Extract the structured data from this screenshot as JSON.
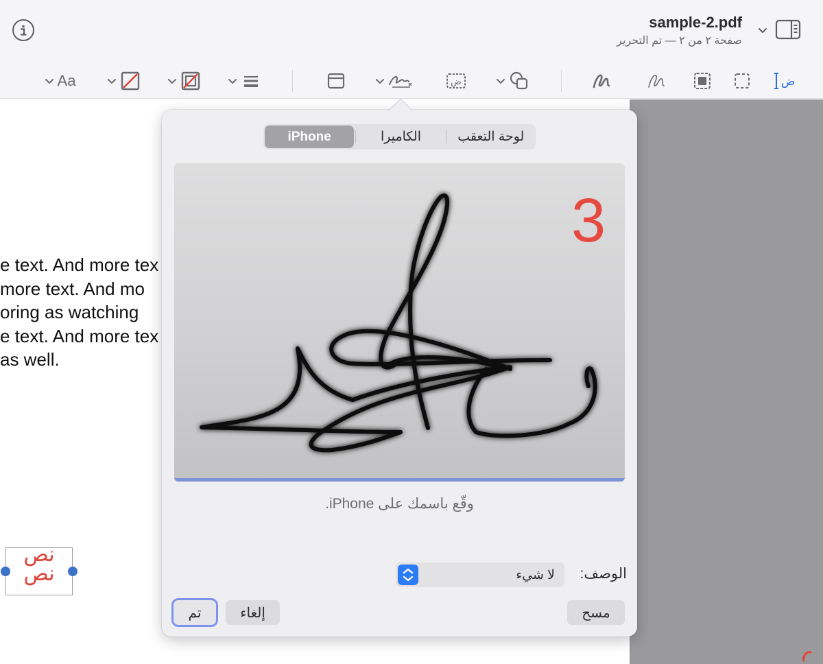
{
  "window": {
    "title": "sample-2.pdf",
    "subtitle": "صفحة ٢ من ٢ — تم التحرير"
  },
  "toolbar": {
    "text_style_label": "Aa",
    "text_select_glyph": "ض",
    "text_box_glyph": "ض",
    "icons": [
      "info-icon",
      "chevron-down-icon",
      "sidebar-toggle-icon",
      "text-select-icon",
      "rect-select-icon",
      "smart-select-icon",
      "sketch-icon",
      "draw-icon",
      "shapes-icon",
      "text-box-icon",
      "sign-icon",
      "note-icon",
      "line-style-icon",
      "border-color-icon",
      "fill-color-icon",
      "text-style-icon"
    ]
  },
  "document": {
    "lines": [
      "e text. And more tex",
      " more text. And mo",
      "oring as watching",
      "e text. And more tex",
      " as well."
    ],
    "annotation_text": "نص نص",
    "annotation_color": "#e0453a"
  },
  "signature_popover": {
    "tabs": [
      {
        "label": "لوحة التعقب",
        "active": false
      },
      {
        "label": "الكاميرا",
        "active": false
      },
      {
        "label": "iPhone",
        "active": true
      }
    ],
    "countdown": "3",
    "countdown_color": "#e5493f",
    "instruction": "وقّع باسمك على iPhone.",
    "description_label": "الوصف:",
    "description_value": "لا شيء",
    "buttons": {
      "clear": "مسح",
      "cancel": "إلغاء",
      "done": "تم"
    },
    "accent_color": "#7e93f0"
  }
}
